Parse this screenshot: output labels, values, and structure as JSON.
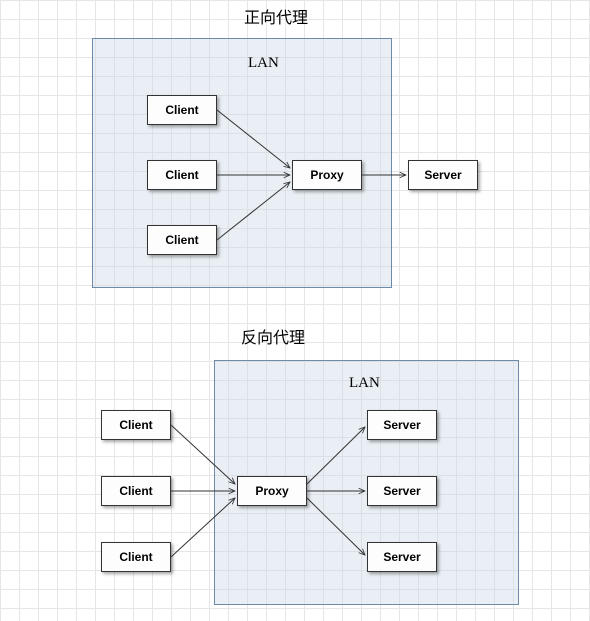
{
  "titles": {
    "forward": "正向代理",
    "reverse": "反向代理"
  },
  "lan_label": "LAN",
  "labels": {
    "client": "Client",
    "proxy": "Proxy",
    "server": "Server"
  },
  "diagrams": {
    "forward": {
      "lan_contains": [
        "client",
        "client",
        "client",
        "proxy"
      ],
      "outside": [
        "server"
      ],
      "edges": [
        [
          "client1",
          "proxy"
        ],
        [
          "client2",
          "proxy"
        ],
        [
          "client3",
          "proxy"
        ],
        [
          "proxy",
          "server"
        ]
      ]
    },
    "reverse": {
      "lan_contains": [
        "proxy",
        "server",
        "server",
        "server"
      ],
      "outside": [
        "client",
        "client",
        "client"
      ],
      "edges": [
        [
          "client1",
          "proxy"
        ],
        [
          "client2",
          "proxy"
        ],
        [
          "client3",
          "proxy"
        ],
        [
          "proxy",
          "server1"
        ],
        [
          "proxy",
          "server2"
        ],
        [
          "proxy",
          "server3"
        ]
      ]
    }
  }
}
